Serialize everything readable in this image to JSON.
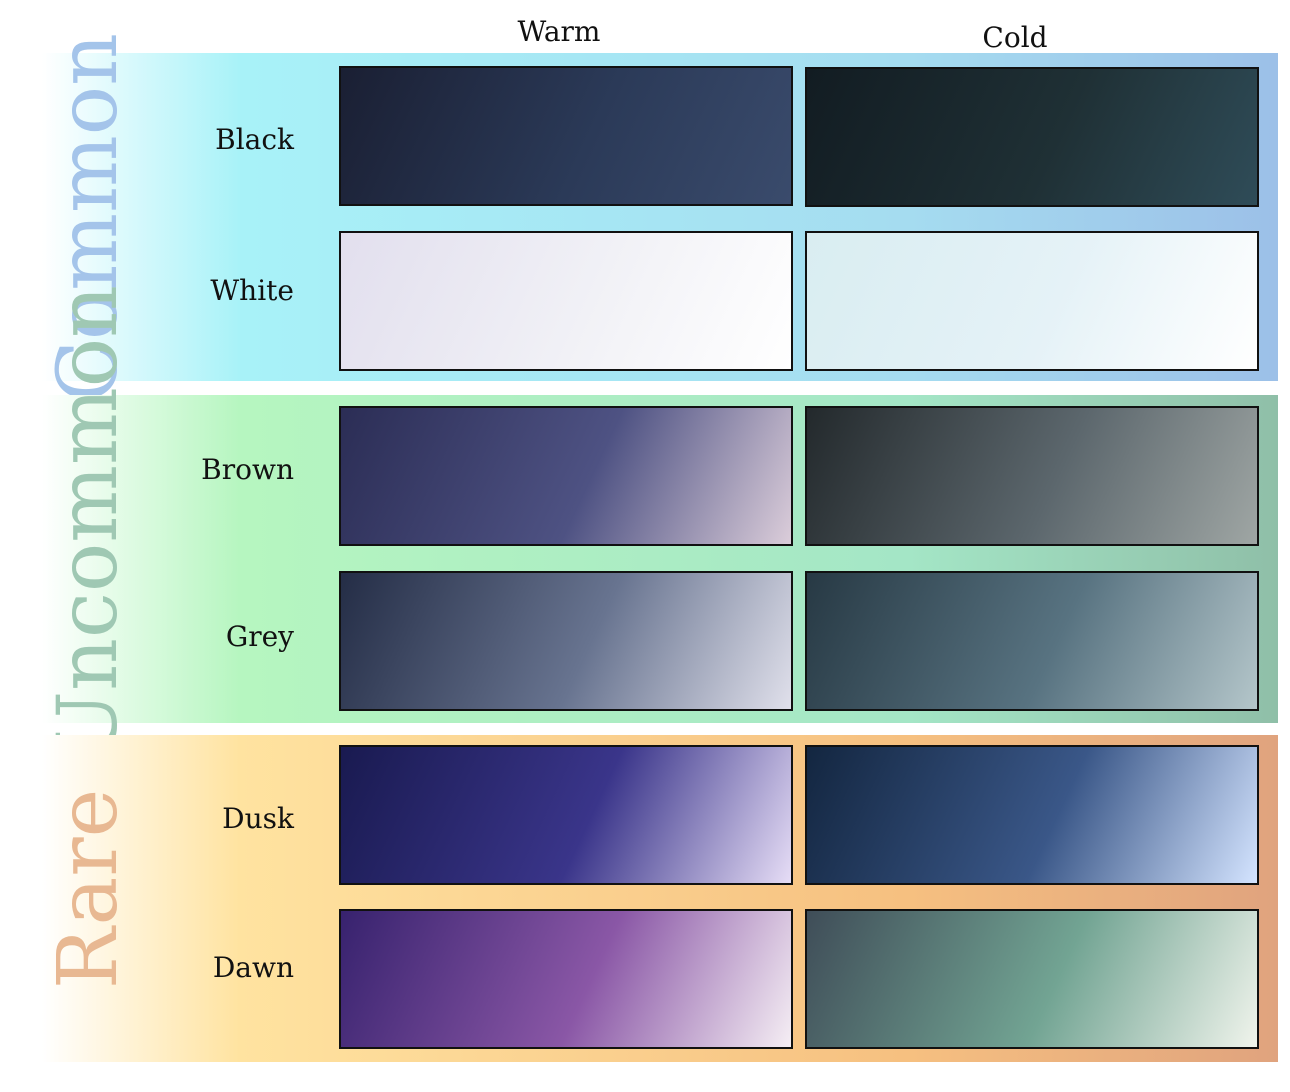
{
  "columns": {
    "warm": "Warm",
    "cold": "Cold"
  },
  "bands": [
    {
      "label": "Common",
      "label_color": "#a4c4ea",
      "background": [
        "#ffffff",
        "#a8f2f8",
        "#a5dcf0",
        "#9cc0e8"
      ],
      "rows": [
        {
          "label": "Black",
          "warm": [
            "#1a1f33",
            "#2b3a58",
            "#3a4b6c"
          ],
          "cold": [
            "#121c22",
            "#1f3035",
            "#2f4c58"
          ]
        },
        {
          "label": "White",
          "warm": [
            "#e2dfee",
            "#f1f1f6",
            "#ffffff"
          ],
          "cold": [
            "#d9edf1",
            "#e5f2f7",
            "#ffffff"
          ]
        }
      ]
    },
    {
      "label": "Uncommon",
      "label_color": "#9fc8b3",
      "background": [
        "#ffffff",
        "#b6f6c0",
        "#a4e6c6",
        "#8fbfa8"
      ],
      "rows": [
        {
          "label": "Brown",
          "warm": [
            "#2b2d55",
            "#4e5283",
            "#dbcdda"
          ],
          "cold": [
            "#23292c",
            "#5c676d",
            "#9fa6a4"
          ]
        },
        {
          "label": "Grey",
          "warm": [
            "#242d46",
            "#687490",
            "#e0e0eb"
          ],
          "cold": [
            "#273944",
            "#587381",
            "#b4c6ca"
          ]
        }
      ]
    },
    {
      "label": "Rare",
      "label_color": "#e8b892",
      "background": [
        "#ffffff",
        "#ffe3a0",
        "#f6c080",
        "#e0a37e"
      ],
      "rows": [
        {
          "label": "Dusk",
          "warm": [
            "#191a50",
            "#3a358a",
            "#e6ddf6"
          ],
          "cold": [
            "#132640",
            "#3a5788",
            "#d4e4ff"
          ]
        },
        {
          "label": "Dawn",
          "warm": [
            "#37226e",
            "#8a57a6",
            "#f5eef4"
          ],
          "cold": [
            "#3f4d58",
            "#72a493",
            "#f0f4ec"
          ]
        }
      ]
    }
  ]
}
